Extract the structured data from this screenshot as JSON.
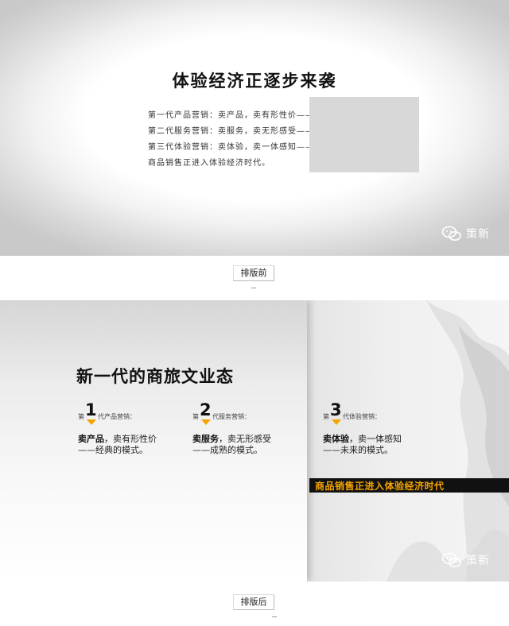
{
  "slide_before": {
    "title": "体验经济正逐步来袭",
    "lines": [
      "第一代产品营销：卖产品，卖有形性价——经典的模式。",
      "第二代服务营销：卖服务，卖无形感受——成熟的模式。",
      "第三代体验营销：卖体验，卖一体感知——未来的模式。",
      "商品销售正进入体验经济时代。"
    ],
    "watermark": "策新"
  },
  "caption_before": "排版前",
  "slide_after": {
    "title": "新一代的商旅文业态",
    "generations": [
      {
        "prefix": "第",
        "number": "1",
        "suffix": "代产品营销：",
        "highlight": "卖产品",
        "line1_rest": "，卖有形性价",
        "line2": "——经典的模式。"
      },
      {
        "prefix": "第",
        "number": "2",
        "suffix": "代服务营销：",
        "highlight": "卖服务",
        "line1_rest": "，卖无形感受",
        "line2": "——成熟的模式。"
      },
      {
        "prefix": "第",
        "number": "3",
        "suffix": "代体验营销：",
        "highlight": "卖体验",
        "line1_rest": "，卖一体感知",
        "line2": "——未来的模式。"
      }
    ],
    "banner": "商品销售正进入体验经济时代",
    "watermark": "策新"
  },
  "caption_after": "排版后",
  "colors": {
    "accent": "#f4a400",
    "banner_bg": "#111111"
  },
  "icons": {
    "watermark": "wechat-icon",
    "marker": "down-triangle-icon"
  }
}
